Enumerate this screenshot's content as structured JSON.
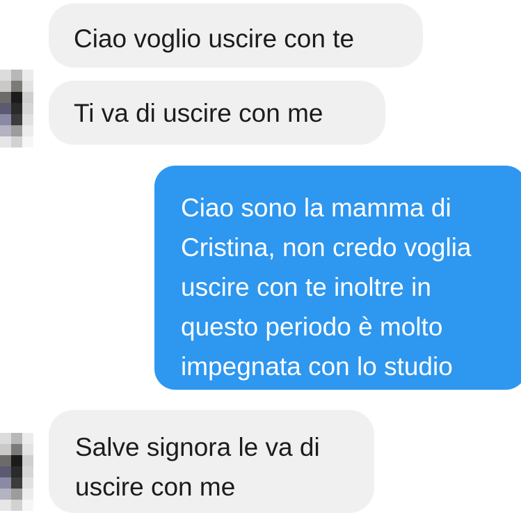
{
  "messages": [
    {
      "id": "msg-1",
      "direction": "incoming",
      "text": "Ciao voglio uscire con te"
    },
    {
      "id": "msg-2",
      "direction": "incoming",
      "text": "Ti va di uscire con me"
    },
    {
      "id": "msg-3",
      "direction": "outgoing",
      "text": "Ciao sono la mamma di\nCristina, non credo voglia\nuscire con te inoltre in\nquesto periodo è molto\nimpegnata con lo studio"
    },
    {
      "id": "msg-4",
      "direction": "incoming",
      "text": "Salve signora le va di\nuscire con me"
    }
  ],
  "colors": {
    "incoming_bubble": "#f0f0f0",
    "outgoing_bubble": "#2e97ef",
    "incoming_text": "#1c1c1c",
    "outgoing_text": "#ffffff"
  },
  "avatars": [
    {
      "name": "pixelated-avatar",
      "pixels": [
        "#dcdcdc",
        "#b8b8b8",
        "#ececec",
        "#c9c9c9",
        "#7c7a76",
        "#e3e3e3",
        "#6e6a6a",
        "#1b1b1b",
        "#cfcfcf",
        "#5c5a70",
        "#2a2a2a",
        "#d6d6d6",
        "#8b8aa6",
        "#3c3c3c",
        "#e1e1e1",
        "#b3b3c2",
        "#9c9c9c",
        "#ececec",
        "#e6e6e6",
        "#d2d2d2",
        "#f6f6f6"
      ]
    },
    {
      "name": "pixelated-avatar",
      "pixels": [
        "#dcdcdc",
        "#b8b8b8",
        "#ececec",
        "#c9c9c9",
        "#7c7a76",
        "#e3e3e3",
        "#6e6a6a",
        "#1b1b1b",
        "#cfcfcf",
        "#5c5a70",
        "#2a2a2a",
        "#d6d6d6",
        "#8b8aa6",
        "#3c3c3c",
        "#e1e1e1",
        "#b3b3c2",
        "#9c9c9c",
        "#ececec",
        "#e6e6e6",
        "#d2d2d2",
        "#f6f6f6"
      ]
    }
  ]
}
